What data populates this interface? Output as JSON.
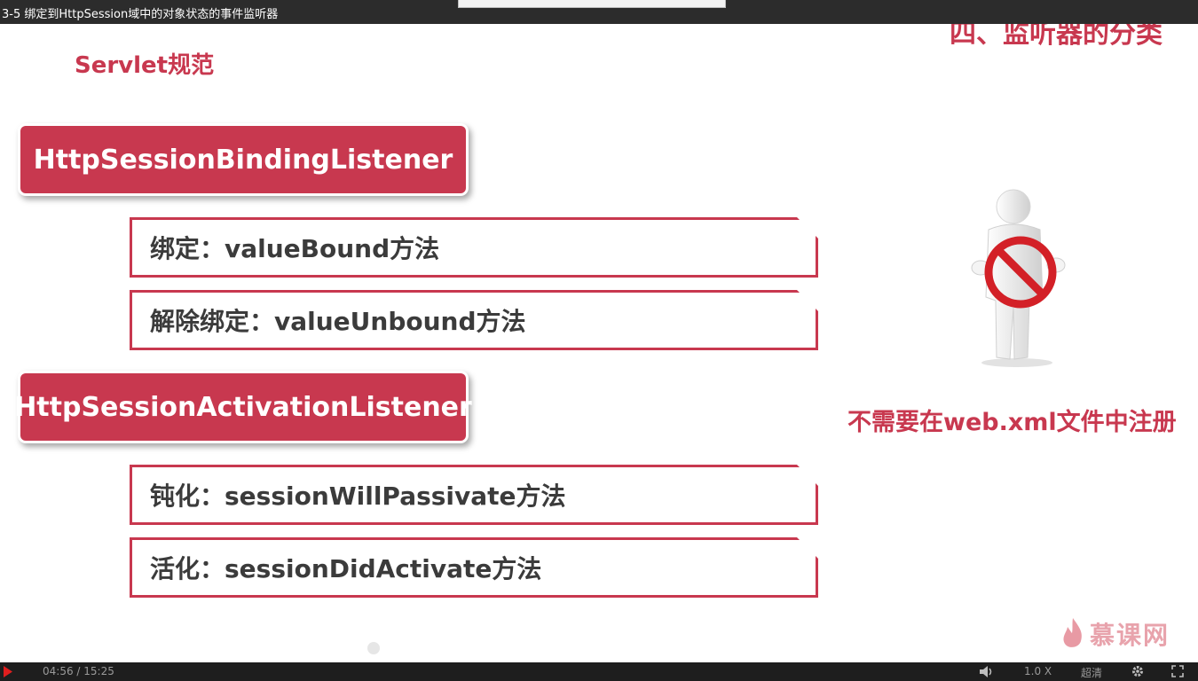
{
  "window": {
    "title": "3-5 绑定到HttpSession域中的对象状态的事件监听器"
  },
  "slide": {
    "section_title": "四、监听器的分类",
    "servlet_label": "Servlet规范",
    "listener1": {
      "name": "HttpSessionBindingListener",
      "methods": [
        "绑定：valueBound方法",
        "解除绑定：valueUnbound方法"
      ]
    },
    "listener2": {
      "name": "HttpSessionActivationListener",
      "methods": [
        "钝化：sessionWillPassivate方法",
        "活化：sessionDidActivate方法"
      ]
    },
    "note": "不需要在web.xml文件中注册"
  },
  "brand": {
    "text": "慕课网"
  },
  "player": {
    "time": "04:56 / 15:25",
    "speed": "1.0 X",
    "quality": "超清",
    "icons": [
      "play-icon",
      "volume-icon",
      "gear-icon",
      "fullscreen-icon"
    ]
  },
  "colors": {
    "accent": "#c8384f",
    "text": "#3b3b3b",
    "titlebar": "#2c2c2c",
    "controls": "#1e1e1e"
  }
}
